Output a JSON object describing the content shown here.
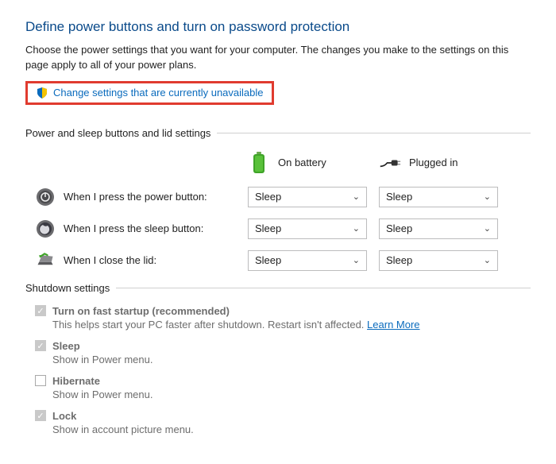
{
  "title": "Define power buttons and turn on password protection",
  "description": "Choose the power settings that you want for your computer. The changes you make to the settings on this page apply to all of your power plans.",
  "change_link": "Change settings that are currently unavailable",
  "sections": {
    "power_sleep": {
      "header": "Power and sleep buttons and lid settings",
      "columns": {
        "battery": "On battery",
        "plugged": "Plugged in"
      },
      "rows": [
        {
          "label": "When I press the power button:",
          "battery": "Sleep",
          "plugged": "Sleep"
        },
        {
          "label": "When I press the sleep button:",
          "battery": "Sleep",
          "plugged": "Sleep"
        },
        {
          "label": "When I close the lid:",
          "battery": "Sleep",
          "plugged": "Sleep"
        }
      ]
    },
    "shutdown": {
      "header": "Shutdown settings",
      "items": [
        {
          "title": "Turn on fast startup (recommended)",
          "desc": "This helps start your PC faster after shutdown. Restart isn't affected.",
          "learn_more": "Learn More",
          "checked": true
        },
        {
          "title": "Sleep",
          "desc": "Show in Power menu.",
          "checked": true
        },
        {
          "title": "Hibernate",
          "desc": "Show in Power menu.",
          "checked": false
        },
        {
          "title": "Lock",
          "desc": "Show in account picture menu.",
          "checked": true
        }
      ]
    }
  }
}
